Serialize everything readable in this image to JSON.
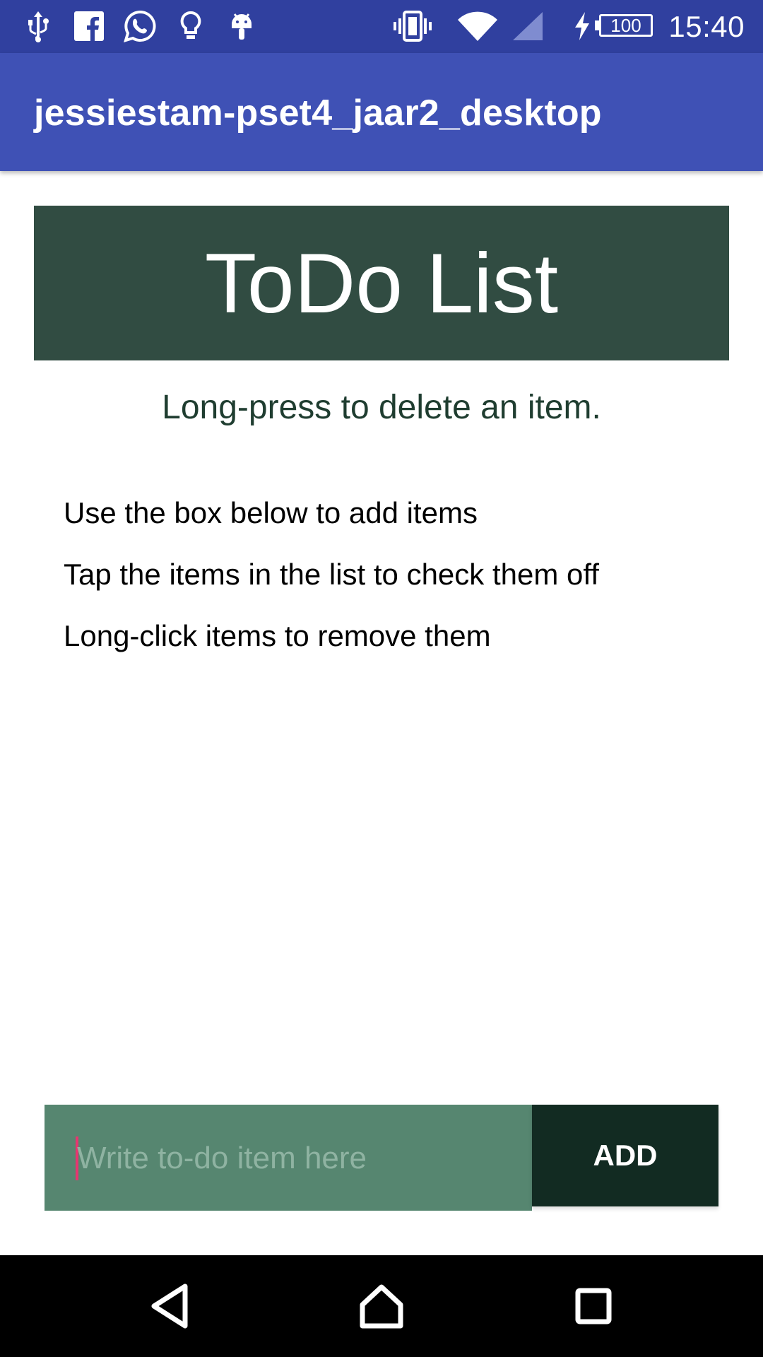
{
  "status_bar": {
    "time": "15:40",
    "battery": "100",
    "icons": [
      "usb-icon",
      "facebook-icon",
      "whatsapp-icon",
      "lightbulb-icon",
      "android-icon",
      "vibrate-icon",
      "wifi-icon",
      "signal-icon",
      "charging-icon",
      "battery-icon"
    ]
  },
  "app_bar": {
    "title": "jessiestam-pset4_jaar2_desktop"
  },
  "header": {
    "title": "ToDo List"
  },
  "hint": "Long-press to delete an item.",
  "instructions": [
    "Use the box below to add items",
    "Tap the items in the list to check them off",
    "Long-click items to remove them"
  ],
  "input": {
    "placeholder": "Write to-do item here",
    "value": ""
  },
  "add_button": {
    "label": "ADD"
  },
  "nav_bar": {
    "buttons": [
      "back-icon",
      "home-icon",
      "recents-icon"
    ]
  },
  "colors": {
    "status_bar": "#30409f",
    "app_bar": "#3f51b5",
    "header_block": "#314c42",
    "input_background": "#568670",
    "add_button": "#122b22",
    "cursor": "#e53670"
  }
}
